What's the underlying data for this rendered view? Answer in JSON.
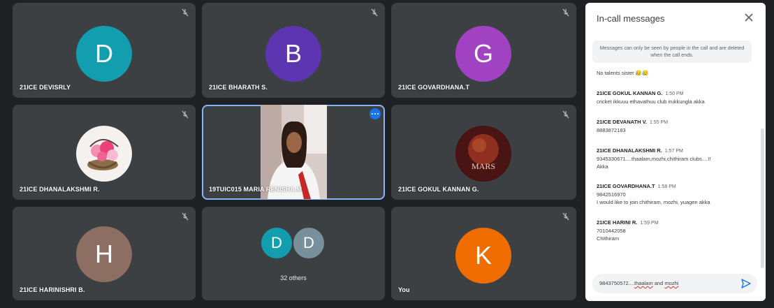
{
  "tiles": [
    {
      "name": "21ICE DEVISRLY",
      "initial": "D",
      "color": "#129eaf"
    },
    {
      "name": "21ICE BHARATH S.",
      "initial": "B",
      "color": "#5e35b1"
    },
    {
      "name": "21ICE GOVARDHANA.T",
      "initial": "G",
      "color": "#a142c3"
    },
    {
      "name": "21ICE DHANALAKSHMI R.",
      "initial": "",
      "color": "#ffffff"
    },
    {
      "name": "19TUIC015 MARIA RENISHA.M",
      "initial": "",
      "color": ""
    },
    {
      "name": "21ICE GOKUL KANNAN G.",
      "initial": "",
      "color": "#6a1b1b",
      "logo_text": "MARS"
    },
    {
      "name": "21ICE HARINISHRI B.",
      "initial": "H",
      "color": "#8d6e63"
    },
    {
      "name": "",
      "initial": "",
      "color": ""
    },
    {
      "name": "You",
      "initial": "K",
      "color": "#ef6c00"
    }
  ],
  "others": {
    "label": "32 others",
    "avatars": [
      {
        "initial": "D",
        "color": "#129eaf"
      },
      {
        "initial": "D",
        "color": "#78909c"
      }
    ]
  },
  "chat": {
    "title": "In-call messages",
    "notice": "Messages can only be seen by people in the call and are deleted when the call ends.",
    "messages": [
      {
        "sender": "",
        "time": "",
        "lines": [
          "No talents sister 😥😥"
        ]
      },
      {
        "sender": "21ICE GOKUL KANNAN G.",
        "time": "1:50 PM",
        "lines": [
          "cricket ikkuuu ethavathuu club irukkungla akka"
        ]
      },
      {
        "sender": "21ICE DEVANATH V.",
        "time": "1:55 PM",
        "lines": [
          "8883872183"
        ]
      },
      {
        "sender": "21ICE DHANALAKSHMI R.",
        "time": "1:57 PM",
        "lines": [
          "9345330671....thaalam,mozhi,chithiram clubs....!!",
          "Akka"
        ]
      },
      {
        "sender": "21ICE GOVARDHANA.T",
        "time": "1:58 PM",
        "lines": [
          "9842516970",
          "I would like to join chithiram, mozhi, yuagen akka"
        ]
      },
      {
        "sender": "21ICE HARINI R.",
        "time": "1:59 PM",
        "lines": [
          "7010442058",
          "Chithiram"
        ]
      }
    ],
    "composer": {
      "prefix": "9843750572....",
      "word1": "thaalam",
      "mid": " and ",
      "word2": "mozhi"
    }
  },
  "colors": {
    "background": "#202124",
    "tile": "#3c4043",
    "accent": "#1a73e8"
  }
}
